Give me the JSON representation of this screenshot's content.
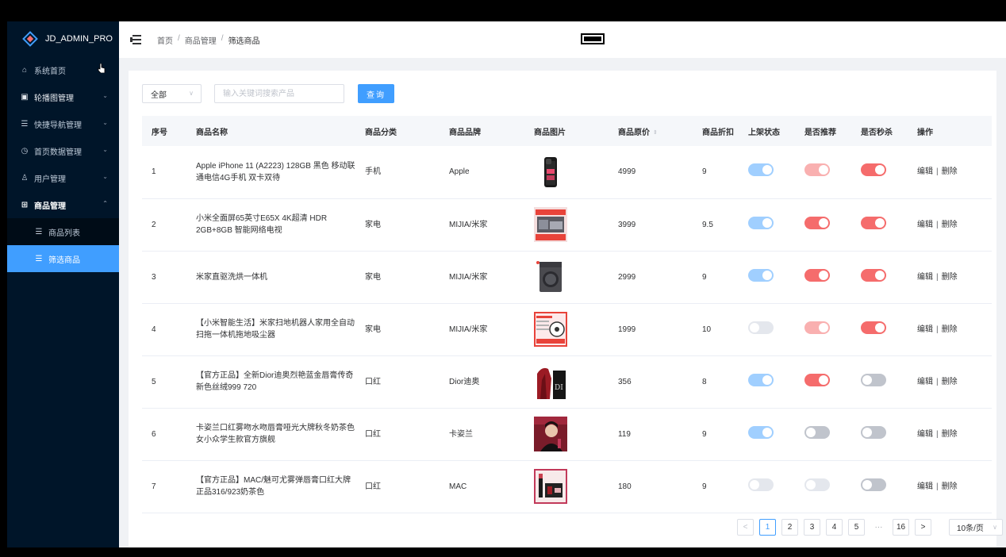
{
  "app": {
    "logo_text": "JD_ADMIN_PRO"
  },
  "sidebar": {
    "items": [
      {
        "label": "系统首页",
        "icon": "home-icon",
        "glyph": "⌂",
        "expandable": false
      },
      {
        "label": "轮播图管理",
        "icon": "image-icon",
        "glyph": "▣",
        "expandable": true
      },
      {
        "label": "快捷导航管理",
        "icon": "list-icon",
        "glyph": "☰",
        "expandable": true
      },
      {
        "label": "首页数据管理",
        "icon": "clock-icon",
        "glyph": "◷",
        "expandable": true
      },
      {
        "label": "用户管理",
        "icon": "user-icon",
        "glyph": "♙",
        "expandable": true
      },
      {
        "label": "商品管理",
        "icon": "grid-icon",
        "glyph": "⊞",
        "expandable": true,
        "open": true
      }
    ],
    "submenu": [
      {
        "label": "商品列表",
        "active": false
      },
      {
        "label": "筛选商品",
        "active": true
      }
    ]
  },
  "breadcrumb": {
    "home": "首页",
    "parent": "商品管理",
    "current": "筛选商品",
    "sep": "/"
  },
  "filter": {
    "select_value": "全部",
    "search_placeholder": "输入关键词搜索产品",
    "search_button": "查询"
  },
  "table": {
    "headers": [
      "序号",
      "商品名称",
      "商品分类",
      "商品品牌",
      "商品图片",
      "商品原价",
      "商品折扣",
      "上架状态",
      "是否推荐",
      "是否秒杀",
      "操作"
    ],
    "edit_label": "编辑",
    "delete_label": "删除",
    "op_sep": "|",
    "rows": [
      {
        "id": "1",
        "name": "Apple iPhone 11 (A2223) 128GB 黑色 移动联通电信4G手机 双卡双待",
        "category": "手机",
        "brand": "Apple",
        "img": "phone",
        "price": "4999",
        "discount": "9",
        "onsale": true,
        "onsale_faded": true,
        "recommend": true,
        "recommend_faded": true,
        "seckill": true,
        "seckill_faded": false
      },
      {
        "id": "2",
        "name": "小米全面屏65英寸E65X 4K超清 HDR 2GB+8GB 智能网络电视",
        "category": "家电",
        "brand": "MIJIA/米家",
        "img": "tv",
        "price": "3999",
        "discount": "9.5",
        "onsale": true,
        "onsale_faded": true,
        "recommend": true,
        "recommend_faded": false,
        "seckill": true,
        "seckill_faded": false
      },
      {
        "id": "3",
        "name": "米家直驱洗烘一体机",
        "category": "家电",
        "brand": "MIJIA/米家",
        "img": "washer",
        "price": "2999",
        "discount": "9",
        "onsale": true,
        "onsale_faded": true,
        "recommend": true,
        "recommend_faded": false,
        "seckill": true,
        "seckill_faded": false
      },
      {
        "id": "4",
        "name": "【小米智能生活】米家扫地机器人家用全自动扫拖一体机拖地吸尘器",
        "category": "家电",
        "brand": "MIJIA/米家",
        "img": "robot",
        "price": "1999",
        "discount": "10",
        "onsale": false,
        "onsale_faded": true,
        "recommend": true,
        "recommend_faded": true,
        "seckill": true,
        "seckill_faded": false
      },
      {
        "id": "5",
        "name": "【官方正品】全新Dior迪奥烈艳蓝金唇膏传奇新色丝绒999 720",
        "category": "口红",
        "brand": "Dior迪奥",
        "img": "dior",
        "price": "356",
        "discount": "8",
        "onsale": true,
        "onsale_faded": true,
        "recommend": true,
        "recommend_faded": false,
        "seckill": false,
        "seckill_faded": false
      },
      {
        "id": "6",
        "name": "卡姿兰口红雾吻水吻唇膏哑光大牌秋冬奶茶色女小众学生款官方旗舰",
        "category": "口红",
        "brand": "卡姿兰",
        "img": "carslan",
        "price": "119",
        "discount": "9",
        "onsale": true,
        "onsale_faded": true,
        "recommend": false,
        "recommend_faded": false,
        "seckill": false,
        "seckill_faded": false
      },
      {
        "id": "7",
        "name": "【官方正品】MAC/魅可尤雾弹唇膏口红大牌正品316/923奶茶色",
        "category": "口红",
        "brand": "MAC",
        "img": "mac",
        "price": "180",
        "discount": "9",
        "onsale": false,
        "onsale_faded": true,
        "recommend": false,
        "recommend_faded": true,
        "seckill": false,
        "seckill_faded": false
      }
    ]
  },
  "pagination": {
    "prev": "<",
    "next": ">",
    "pages": [
      "1",
      "2",
      "3",
      "4",
      "5"
    ],
    "ellipsis": "···",
    "last": "16",
    "current": "1",
    "page_size": "10条/页"
  },
  "colors": {
    "primary": "#409eff",
    "sidebar_bg": "#001529",
    "danger": "#f56c6c",
    "off": "#c0c4cc"
  }
}
